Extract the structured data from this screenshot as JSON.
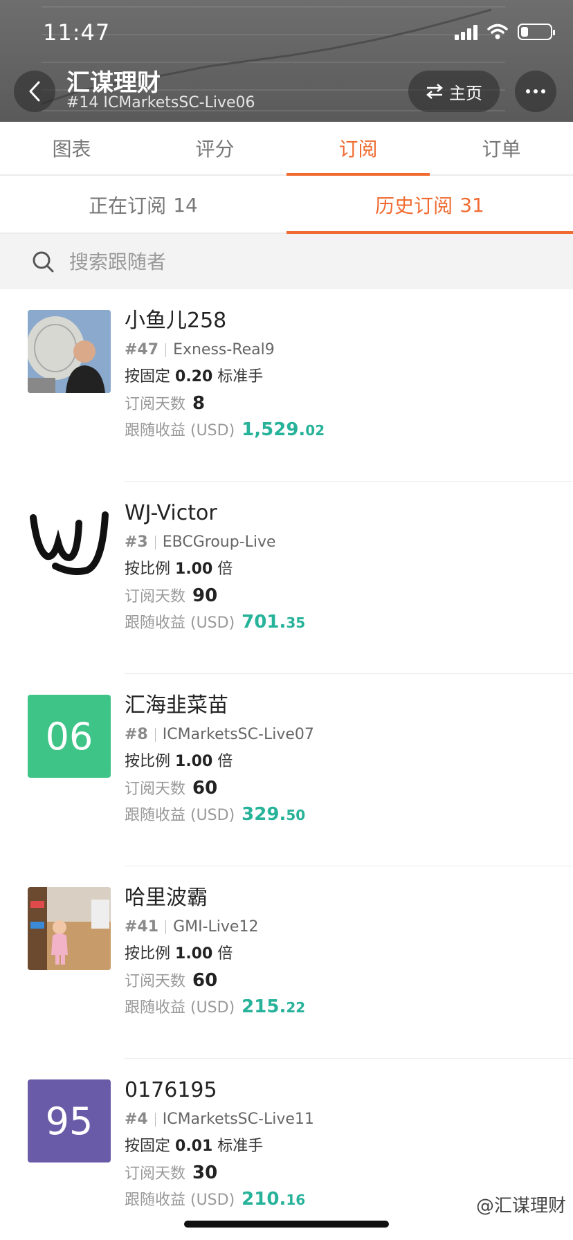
{
  "status_bar": {
    "time": "11:47"
  },
  "header": {
    "title": "汇谋理财",
    "subtitle": "#14 ICMarketsSC-Live06",
    "home_label": "主页"
  },
  "tabs": [
    {
      "label": "图表",
      "active": false
    },
    {
      "label": "评分",
      "active": false
    },
    {
      "label": "订阅",
      "active": true
    },
    {
      "label": "订单",
      "active": false
    }
  ],
  "subtabs": [
    {
      "label": "正在订阅",
      "count": "14",
      "active": false
    },
    {
      "label": "历史订阅",
      "count": "31",
      "active": true
    }
  ],
  "search": {
    "placeholder": "搜索跟随者"
  },
  "labels": {
    "days": "订阅天数",
    "profit": "跟随收益 (USD)"
  },
  "followers": [
    {
      "name": "小鱼儿258",
      "rank": "#47",
      "server": "Exness-Real9",
      "mode_prefix": "按固定",
      "mode_value": "0.20",
      "mode_suffix": "标准手",
      "days": "8",
      "profit_int": "1,529.",
      "profit_dec": "02",
      "avatar_text": "",
      "avatar_color": "#5a7fa8"
    },
    {
      "name": "WJ-Victor",
      "rank": "#3",
      "server": "EBCGroup-Live",
      "mode_prefix": "按比例",
      "mode_value": "1.00",
      "mode_suffix": "倍",
      "days": "90",
      "profit_int": "701.",
      "profit_dec": "35",
      "avatar_text": "",
      "avatar_color": "#ffffff"
    },
    {
      "name": "汇海韭菜苗",
      "rank": "#8",
      "server": "ICMarketsSC-Live07",
      "mode_prefix": "按比例",
      "mode_value": "1.00",
      "mode_suffix": "倍",
      "days": "60",
      "profit_int": "329.",
      "profit_dec": "50",
      "avatar_text": "06",
      "avatar_color": "#3fc488"
    },
    {
      "name": "哈里波霸",
      "rank": "#41",
      "server": "GMI-Live12",
      "mode_prefix": "按比例",
      "mode_value": "1.00",
      "mode_suffix": "倍",
      "days": "60",
      "profit_int": "215.",
      "profit_dec": "22",
      "avatar_text": "",
      "avatar_color": "#b58a5c"
    },
    {
      "name": "0176195",
      "rank": "#4",
      "server": "ICMarketsSC-Live11",
      "mode_prefix": "按固定",
      "mode_value": "0.01",
      "mode_suffix": "标准手",
      "days": "30",
      "profit_int": "210.",
      "profit_dec": "16",
      "avatar_text": "95",
      "avatar_color": "#6a5ba8"
    }
  ],
  "watermark": "@汇谋理财",
  "colors": {
    "accent": "#f06b31",
    "profit": "#27b29a"
  }
}
